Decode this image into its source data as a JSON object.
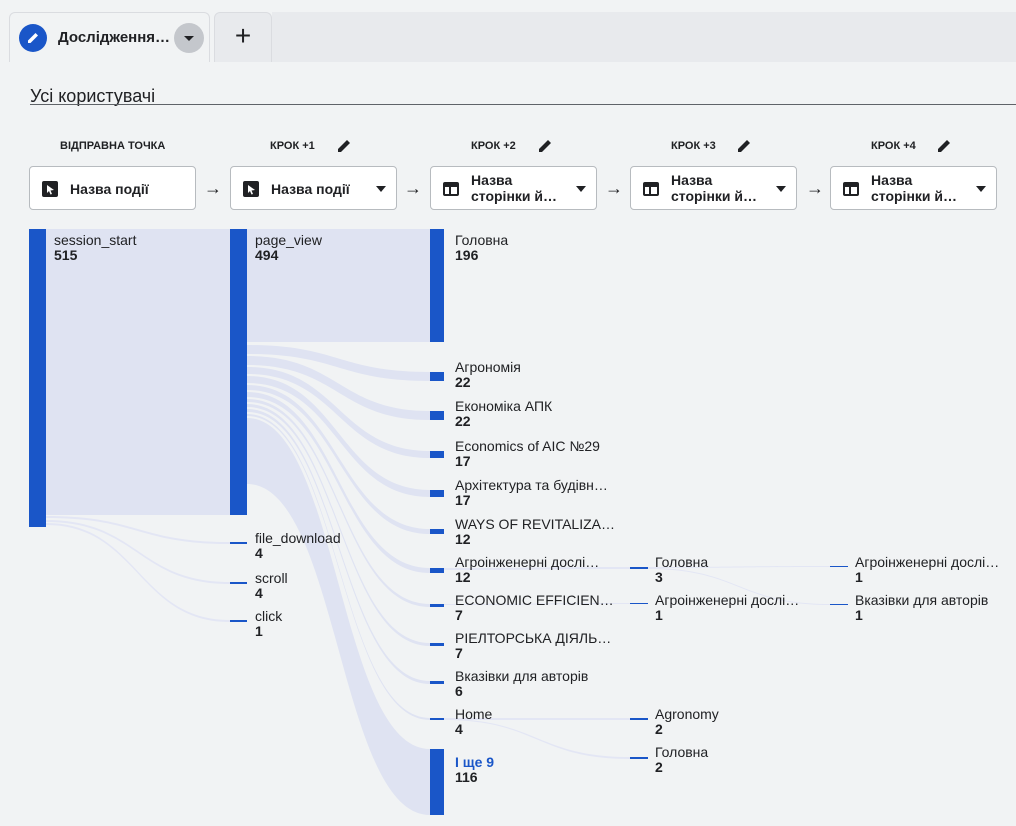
{
  "tab": {
    "title": "Дослідження…",
    "add_label": "+"
  },
  "segment": "Усі користувачі",
  "steps": [
    {
      "title": "ВІДПРАВНА ТОЧКА",
      "dropdown": "Назва події"
    },
    {
      "title": "КРОК +1",
      "dropdown": "Назва події"
    },
    {
      "title": "КРОК +2",
      "dropdown_line1": "Назва",
      "dropdown_line2": "сторінки й…"
    },
    {
      "title": "КРОК +3",
      "dropdown_line1": "Назва",
      "dropdown_line2": "сторінки й…"
    },
    {
      "title": "КРОК +4",
      "dropdown_line1": "Назва",
      "dropdown_line2": "сторінки й…"
    }
  ],
  "arrow_glyph": "→",
  "colors": {
    "node": "#1a56c8",
    "flow": "#dfe3f2",
    "flow_thin": "#e3e6f4"
  },
  "chart_data": {
    "type": "sankey",
    "columns": [
      [
        {
          "name": "session_start",
          "value": 515
        }
      ],
      [
        {
          "name": "page_view",
          "value": 494
        },
        {
          "name": "file_download",
          "value": 4
        },
        {
          "name": "scroll",
          "value": 4
        },
        {
          "name": "click",
          "value": 1
        }
      ],
      [
        {
          "name": "Головна",
          "value": 196
        },
        {
          "name": "Агрономія",
          "value": 22
        },
        {
          "name": "Економіка АПК",
          "value": 22
        },
        {
          "name": "Economics of AIC №29",
          "value": 17
        },
        {
          "name": "Архітектура та будівн…",
          "value": 17
        },
        {
          "name": "WAYS OF REVITALIZA…",
          "value": 12
        },
        {
          "name": "Агроінженерні дослі…",
          "value": 12
        },
        {
          "name": "ECONOMIC EFFICIEN…",
          "value": 7
        },
        {
          "name": "РІЕЛТОРСЬКА ДІЯЛЬ…",
          "value": 7
        },
        {
          "name": "Вказівки для авторів",
          "value": 6
        },
        {
          "name": "Home",
          "value": 4
        },
        {
          "name": "І ще 9",
          "value": 116
        }
      ],
      [
        {
          "name": "Головна",
          "value": 3
        },
        {
          "name": "Агроінженерні дослі…",
          "value": 1
        },
        {
          "name": "Agronomy",
          "value": 2
        },
        {
          "name": "Головна",
          "value": 2
        }
      ],
      [
        {
          "name": "Агроінженерні дослі…",
          "value": 1
        },
        {
          "name": "Вказівки для авторів",
          "value": 1
        }
      ]
    ]
  }
}
